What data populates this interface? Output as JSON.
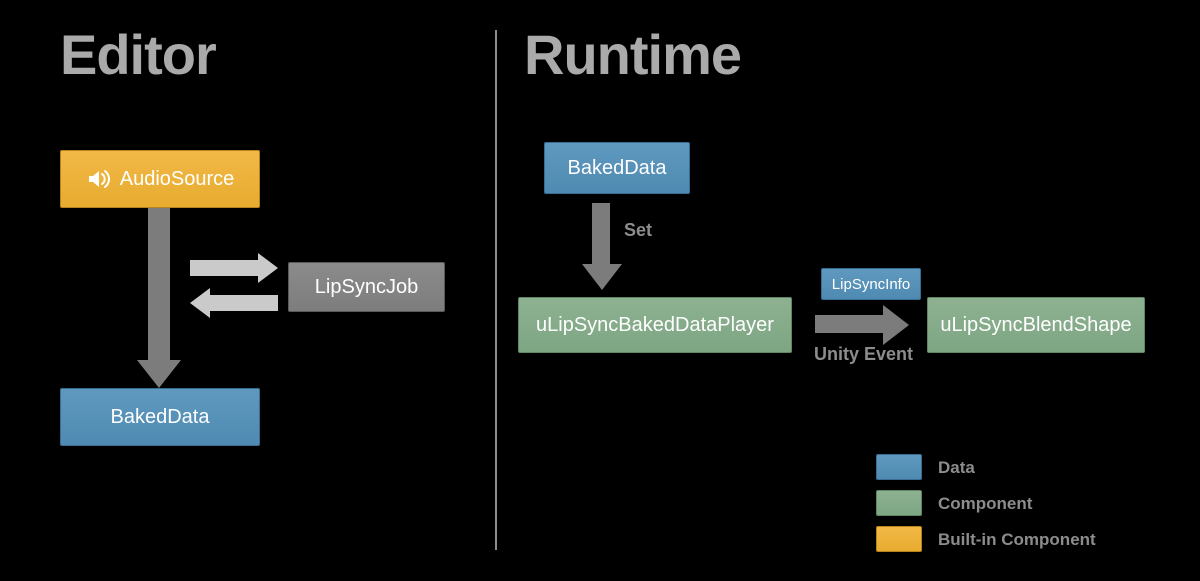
{
  "headings": {
    "left": "Editor",
    "right": "Runtime"
  },
  "editor": {
    "audioSource": "AudioSource",
    "lipSyncJob": "LipSyncJob",
    "bakedData": "BakedData"
  },
  "runtime": {
    "bakedData": "BakedData",
    "player": "uLipSyncBakedDataPlayer",
    "blendShape": "uLipSyncBlendShape",
    "lipSyncInfo": "LipSyncInfo",
    "edge_set": "Set",
    "edge_unityEvent": "Unity Event"
  },
  "legend": {
    "data": "Data",
    "component": "Component",
    "builtin": "Built-in Component"
  }
}
